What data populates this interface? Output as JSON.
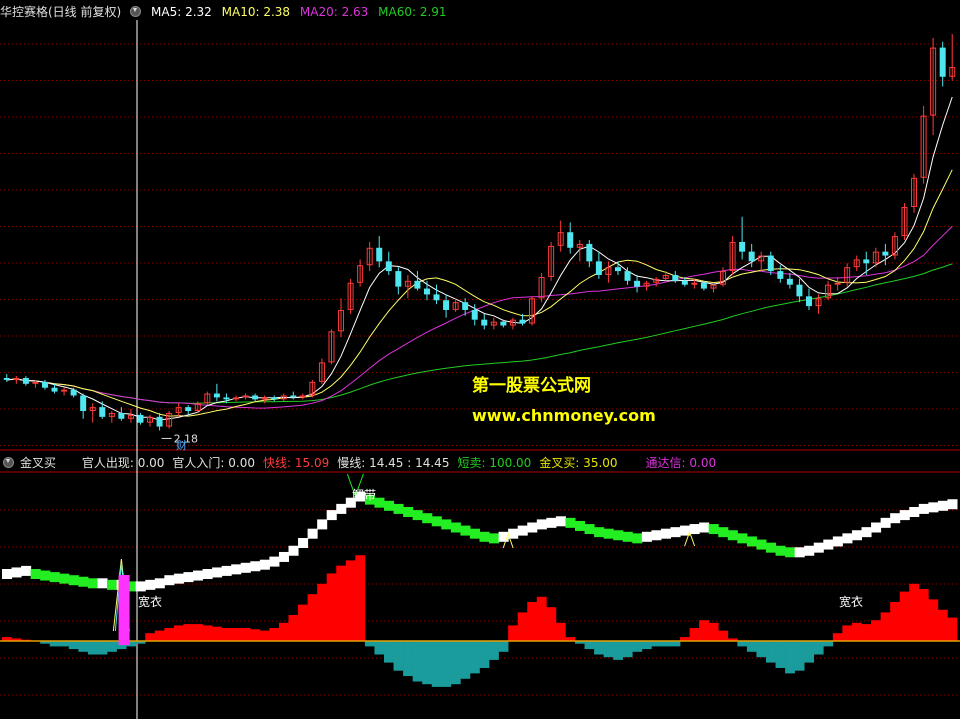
{
  "main_header": {
    "title": "华控赛格(日线 前复权)",
    "ma5": "MA5: 2.32",
    "ma10": "MA10: 2.38",
    "ma20": "MA20: 2.63",
    "ma60": "MA60: 2.91"
  },
  "sub_header": {
    "title": "金叉买",
    "items": [
      {
        "text": "官人出现: 0.00",
        "color": "#e0e0e0"
      },
      {
        "text": "官人入门: 0.00",
        "color": "#e0e0e0"
      },
      {
        "text": "快线: 15.09",
        "color": "#ff3b3b"
      },
      {
        "text": "慢线: 14.45 : 14.45",
        "color": "#e0e0e0"
      },
      {
        "text": "短卖: 100.00",
        "color": "#22cc22"
      },
      {
        "text": "金叉买: 35.00",
        "color": "#e6e600"
      },
      {
        "text": "通达信: 0.00",
        "color": "#dd33dd"
      }
    ]
  },
  "watermark": {
    "line1": "第一股票公式网",
    "line2": "www.chnmoney.com"
  },
  "annotations": {
    "low_price": "2.18",
    "cai": "财",
    "jie_dai": "解带",
    "guan_yi": "宽衣"
  },
  "colors": {
    "up": "#ff3b3b",
    "down": "#4fe6f0",
    "ma5": "#ffffff",
    "ma10": "#ffff66",
    "ma20": "#dd33dd",
    "ma60": "#22cc22",
    "grid": "#8a0000",
    "fast_up": "#ffffff",
    "fast_down": "#22ee22",
    "osc_pos": "#ff0000",
    "osc_neg": "#1a9c9c",
    "zero_line": "#e6a000"
  },
  "chart_data": {
    "type": "candlestick",
    "candles": [
      [
        2.45,
        2.47,
        2.43,
        2.44
      ],
      [
        2.44,
        2.46,
        2.42,
        2.45
      ],
      [
        2.45,
        2.46,
        2.41,
        2.42
      ],
      [
        2.42,
        2.44,
        2.4,
        2.43
      ],
      [
        2.43,
        2.44,
        2.39,
        2.4
      ],
      [
        2.4,
        2.42,
        2.37,
        2.38
      ],
      [
        2.38,
        2.4,
        2.36,
        2.39
      ],
      [
        2.39,
        2.4,
        2.35,
        2.36
      ],
      [
        2.36,
        2.37,
        2.24,
        2.28
      ],
      [
        2.28,
        2.32,
        2.22,
        2.3
      ],
      [
        2.3,
        2.33,
        2.24,
        2.25
      ],
      [
        2.25,
        2.28,
        2.22,
        2.27
      ],
      [
        2.27,
        2.3,
        2.23,
        2.24
      ],
      [
        2.24,
        2.29,
        2.22,
        2.26
      ],
      [
        2.26,
        2.27,
        2.21,
        2.22
      ],
      [
        2.22,
        2.26,
        2.2,
        2.25
      ],
      [
        2.25,
        2.27,
        2.18,
        2.2
      ],
      [
        2.2,
        2.28,
        2.19,
        2.27
      ],
      [
        2.27,
        2.32,
        2.25,
        2.3
      ],
      [
        2.3,
        2.31,
        2.26,
        2.28
      ],
      [
        2.28,
        2.33,
        2.27,
        2.32
      ],
      [
        2.32,
        2.38,
        2.31,
        2.37
      ],
      [
        2.37,
        2.42,
        2.33,
        2.35
      ],
      [
        2.35,
        2.37,
        2.32,
        2.34
      ],
      [
        2.34,
        2.36,
        2.33,
        2.35
      ],
      [
        2.35,
        2.37,
        2.34,
        2.36
      ],
      [
        2.36,
        2.37,
        2.33,
        2.34
      ],
      [
        2.34,
        2.36,
        2.32,
        2.35
      ],
      [
        2.35,
        2.36,
        2.33,
        2.34
      ],
      [
        2.34,
        2.37,
        2.33,
        2.36
      ],
      [
        2.36,
        2.38,
        2.34,
        2.35
      ],
      [
        2.35,
        2.37,
        2.34,
        2.36
      ],
      [
        2.36,
        2.44,
        2.35,
        2.43
      ],
      [
        2.43,
        2.55,
        2.42,
        2.53
      ],
      [
        2.53,
        2.7,
        2.52,
        2.69
      ],
      [
        2.69,
        2.86,
        2.66,
        2.8
      ],
      [
        2.8,
        2.96,
        2.78,
        2.94
      ],
      [
        2.94,
        3.06,
        2.92,
        3.03
      ],
      [
        3.03,
        3.15,
        3.0,
        3.12
      ],
      [
        3.12,
        3.18,
        3.02,
        3.05
      ],
      [
        3.05,
        3.1,
        2.98,
        3.0
      ],
      [
        3.0,
        3.02,
        2.88,
        2.92
      ],
      [
        2.92,
        2.98,
        2.86,
        2.95
      ],
      [
        2.95,
        3.0,
        2.9,
        2.91
      ],
      [
        2.91,
        2.95,
        2.85,
        2.88
      ],
      [
        2.88,
        2.93,
        2.83,
        2.85
      ],
      [
        2.85,
        2.88,
        2.76,
        2.8
      ],
      [
        2.8,
        2.86,
        2.79,
        2.84
      ],
      [
        2.84,
        2.86,
        2.77,
        2.8
      ],
      [
        2.8,
        2.83,
        2.72,
        2.75
      ],
      [
        2.75,
        2.78,
        2.7,
        2.72
      ],
      [
        2.72,
        2.76,
        2.7,
        2.74
      ],
      [
        2.74,
        2.75,
        2.71,
        2.72
      ],
      [
        2.72,
        2.76,
        2.7,
        2.75
      ],
      [
        2.75,
        2.78,
        2.72,
        2.73
      ],
      [
        2.73,
        2.87,
        2.72,
        2.86
      ],
      [
        2.86,
        2.99,
        2.84,
        2.97
      ],
      [
        2.97,
        3.15,
        2.95,
        3.13
      ],
      [
        3.13,
        3.26,
        3.1,
        3.2
      ],
      [
        3.2,
        3.25,
        3.09,
        3.12
      ],
      [
        3.12,
        3.16,
        3.05,
        3.14
      ],
      [
        3.14,
        3.16,
        3.02,
        3.05
      ],
      [
        3.05,
        3.1,
        2.96,
        2.98
      ],
      [
        2.98,
        3.05,
        2.94,
        3.02
      ],
      [
        3.02,
        3.05,
        2.98,
        3.0
      ],
      [
        3.0,
        3.02,
        2.93,
        2.95
      ],
      [
        2.95,
        2.98,
        2.89,
        2.92
      ],
      [
        2.92,
        2.95,
        2.9,
        2.94
      ],
      [
        2.94,
        2.97,
        2.92,
        2.96
      ],
      [
        2.96,
        3.0,
        2.95,
        2.98
      ],
      [
        2.98,
        3.0,
        2.94,
        2.95
      ],
      [
        2.95,
        2.97,
        2.92,
        2.93
      ],
      [
        2.93,
        2.96,
        2.91,
        2.94
      ],
      [
        2.94,
        2.95,
        2.9,
        2.91
      ],
      [
        2.91,
        2.94,
        2.89,
        2.93
      ],
      [
        2.93,
        3.02,
        2.92,
        3.0
      ],
      [
        3.0,
        3.18,
        2.98,
        3.15
      ],
      [
        3.15,
        3.28,
        3.06,
        3.1
      ],
      [
        3.1,
        3.14,
        3.02,
        3.05
      ],
      [
        3.05,
        3.1,
        3.0,
        3.08
      ],
      [
        3.08,
        3.1,
        2.98,
        3.0
      ],
      [
        3.0,
        3.03,
        2.94,
        2.96
      ],
      [
        2.96,
        2.99,
        2.91,
        2.93
      ],
      [
        2.93,
        2.96,
        2.84,
        2.87
      ],
      [
        2.87,
        2.91,
        2.8,
        2.82
      ],
      [
        2.82,
        2.88,
        2.78,
        2.86
      ],
      [
        2.86,
        2.95,
        2.85,
        2.93
      ],
      [
        2.93,
        2.97,
        2.9,
        2.94
      ],
      [
        2.94,
        3.04,
        2.92,
        3.02
      ],
      [
        3.02,
        3.08,
        3.0,
        3.06
      ],
      [
        3.06,
        3.1,
        2.98,
        3.04
      ],
      [
        3.04,
        3.12,
        3.02,
        3.1
      ],
      [
        3.1,
        3.14,
        3.03,
        3.08
      ],
      [
        3.08,
        3.2,
        3.06,
        3.18
      ],
      [
        3.18,
        3.35,
        3.16,
        3.33
      ],
      [
        3.33,
        3.5,
        3.3,
        3.48
      ],
      [
        3.48,
        3.85,
        3.45,
        3.8
      ],
      [
        3.8,
        4.2,
        3.7,
        4.15
      ],
      [
        4.15,
        4.18,
        3.95,
        4.0
      ],
      [
        4.0,
        4.22,
        3.98,
        4.05
      ]
    ],
    "low_annotation": 2.18,
    "ylim": [
      2.1,
      4.22
    ]
  },
  "osc_data": {
    "hist": [
      3,
      2,
      1,
      0,
      -1,
      -2,
      -2,
      -3,
      -4,
      -5,
      -5,
      -4,
      -3,
      -2,
      -1,
      6,
      8,
      10,
      12,
      13,
      13,
      12,
      11,
      10,
      10,
      10,
      9,
      8,
      10,
      14,
      20,
      28,
      36,
      44,
      52,
      58,
      62,
      66,
      -2,
      -5,
      -8,
      -11,
      -13,
      -15,
      -16,
      -17,
      -17,
      -16,
      -14,
      -12,
      -10,
      -7,
      -4,
      12,
      22,
      30,
      34,
      26,
      14,
      3,
      -1,
      -3,
      -5,
      -6,
      -7,
      -6,
      -4,
      -3,
      -2,
      -2,
      -2,
      3,
      10,
      16,
      14,
      8,
      2,
      -2,
      -4,
      -6,
      -8,
      -10,
      -12,
      -11,
      -8,
      -5,
      -2,
      6,
      12,
      14,
      13,
      16,
      22,
      30,
      38,
      44,
      40,
      32,
      24,
      18
    ],
    "fast": [
      20,
      21,
      22,
      20,
      19,
      18,
      17,
      16,
      15,
      14,
      14,
      13,
      13,
      12,
      12,
      13,
      14,
      16,
      17,
      18,
      19,
      20,
      21,
      22,
      23,
      24,
      25,
      26,
      28,
      31,
      35,
      40,
      46,
      52,
      58,
      62,
      66,
      70,
      68,
      66,
      64,
      62,
      60,
      58,
      56,
      54,
      52,
      50,
      48,
      46,
      44,
      43,
      44,
      46,
      48,
      50,
      52,
      53,
      54,
      53,
      51,
      49,
      47,
      46,
      45,
      44,
      43,
      44,
      45,
      46,
      47,
      48,
      49,
      50,
      49,
      47,
      45,
      43,
      41,
      39,
      37,
      35,
      34,
      34,
      35,
      37,
      39,
      41,
      43,
      45,
      47,
      50,
      53,
      56,
      58,
      60,
      62,
      63,
      64,
      65
    ],
    "slow": [
      20,
      20,
      21,
      21,
      21,
      20,
      19,
      18,
      17,
      17,
      16,
      16,
      15,
      15,
      15,
      15,
      15,
      15,
      16,
      17,
      17,
      18,
      19,
      20,
      21,
      22,
      23,
      24,
      25,
      26,
      28,
      31,
      34,
      38,
      42,
      46,
      50,
      54,
      56,
      57,
      58,
      58,
      58,
      57,
      57,
      56,
      55,
      53,
      51,
      50,
      48,
      47,
      46,
      46,
      46,
      47,
      48,
      49,
      50,
      51,
      51,
      50,
      50,
      49,
      48,
      47,
      46,
      45,
      45,
      45,
      46,
      46,
      47,
      48,
      48,
      47,
      46,
      45,
      44,
      42,
      41,
      39,
      38,
      37,
      37,
      37,
      38,
      39,
      40,
      41,
      43,
      44,
      46,
      48,
      50,
      52,
      54,
      56,
      57,
      58
    ],
    "signal_markers": [
      {
        "index": 12,
        "kind": "green_spike"
      },
      {
        "index": 16,
        "kind": "magenta_bar"
      }
    ]
  }
}
